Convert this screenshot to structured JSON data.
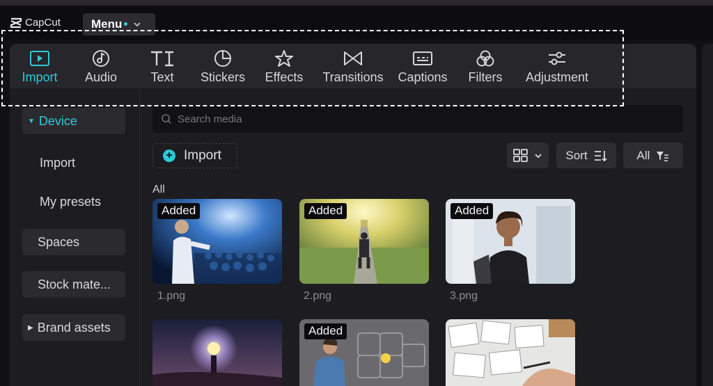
{
  "app": {
    "logo_text": "CapCut",
    "menu_label": "Menu"
  },
  "toolbar": {
    "active": "Import",
    "items": [
      {
        "label": "Import",
        "icon": "import-icon"
      },
      {
        "label": "Audio",
        "icon": "audio-icon"
      },
      {
        "label": "Text",
        "icon": "text-icon"
      },
      {
        "label": "Stickers",
        "icon": "stickers-icon"
      },
      {
        "label": "Effects",
        "icon": "effects-icon"
      },
      {
        "label": "Transitions",
        "icon": "transitions-icon"
      },
      {
        "label": "Captions",
        "icon": "captions-icon"
      },
      {
        "label": "Filters",
        "icon": "filters-icon"
      },
      {
        "label": "Adjustment",
        "icon": "adjustment-icon"
      }
    ]
  },
  "sidebar": {
    "items": [
      {
        "label": "Device"
      },
      {
        "label": "Import"
      },
      {
        "label": "My presets"
      },
      {
        "label": "Spaces"
      },
      {
        "label": "Stock mate..."
      },
      {
        "label": "Brand assets"
      }
    ]
  },
  "search": {
    "placeholder": "Search media"
  },
  "import_button": {
    "label": "Import"
  },
  "controls": {
    "sort_label": "Sort",
    "filter_label": "All"
  },
  "media": {
    "heading": "All",
    "added_label": "Added",
    "items": [
      {
        "name": "1.png",
        "added": true
      },
      {
        "name": "2.png",
        "added": true
      },
      {
        "name": "3.png",
        "added": true
      },
      {
        "name": "",
        "added": false
      },
      {
        "name": "",
        "added": true
      },
      {
        "name": "",
        "added": false
      }
    ]
  },
  "colors": {
    "accent": "#2fc9d8",
    "background": "#1d1d21",
    "toolbar": "#26262b"
  }
}
